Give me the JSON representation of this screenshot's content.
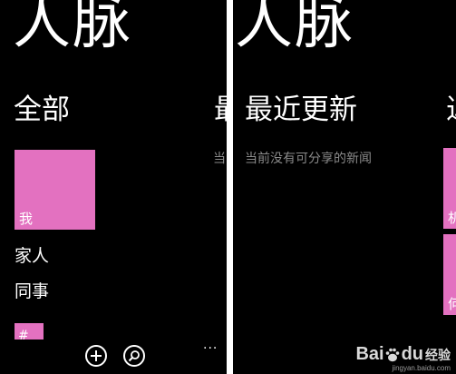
{
  "hub": {
    "title": "人脉"
  },
  "left_panel": {
    "section": "全部",
    "next_section_peek": "最",
    "peek_empty_text": "当",
    "me_tile": {
      "label": "我",
      "color": "#e371c0"
    },
    "groups": [
      "家人",
      "同事"
    ],
    "alpha_tile": {
      "label": "#"
    }
  },
  "right_panel": {
    "section": "最近更新",
    "empty_text": "当前没有可分享的新闻",
    "next_section_peek": "近",
    "peek_tiles": [
      "机",
      "何"
    ]
  },
  "app_bar": {
    "more": "..."
  },
  "watermark": {
    "brand_left": "Bai",
    "brand_right": "du",
    "brand_cn": "经验",
    "url": "jingyan.baidu.com"
  },
  "colors": {
    "accent": "#e371c0",
    "background": "#000000",
    "secondary_text": "#8a8a8a"
  },
  "icons": [
    "add-icon",
    "search-icon",
    "baidu-paw-icon"
  ]
}
